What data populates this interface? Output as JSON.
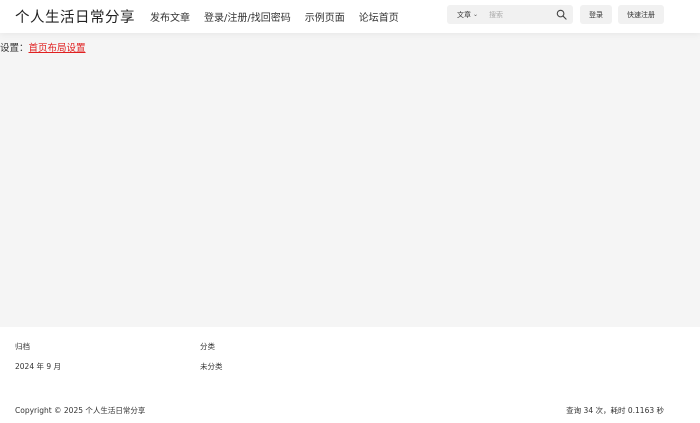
{
  "header": {
    "site_title": "个人生活日常分享",
    "nav": [
      "发布文章",
      "登录/注册/找回密码",
      "示例页面",
      "论坛首页"
    ],
    "search": {
      "type_label": "文章",
      "placeholder": "搜索",
      "icon": "search-icon"
    },
    "login_label": "登录",
    "register_label": "快速注册"
  },
  "notice": {
    "prefix": "设置：",
    "link_label": "首页布局设置",
    "link_color": "#e02020"
  },
  "footer": {
    "archive_heading": "归档",
    "archive_item": "2024 年 9 月",
    "category_heading": "分类",
    "category_item": "未分类",
    "copyright": "Copyright © 2025 个人生活日常分享",
    "stats": "查询 34 次，耗时 0.1163 秒"
  }
}
